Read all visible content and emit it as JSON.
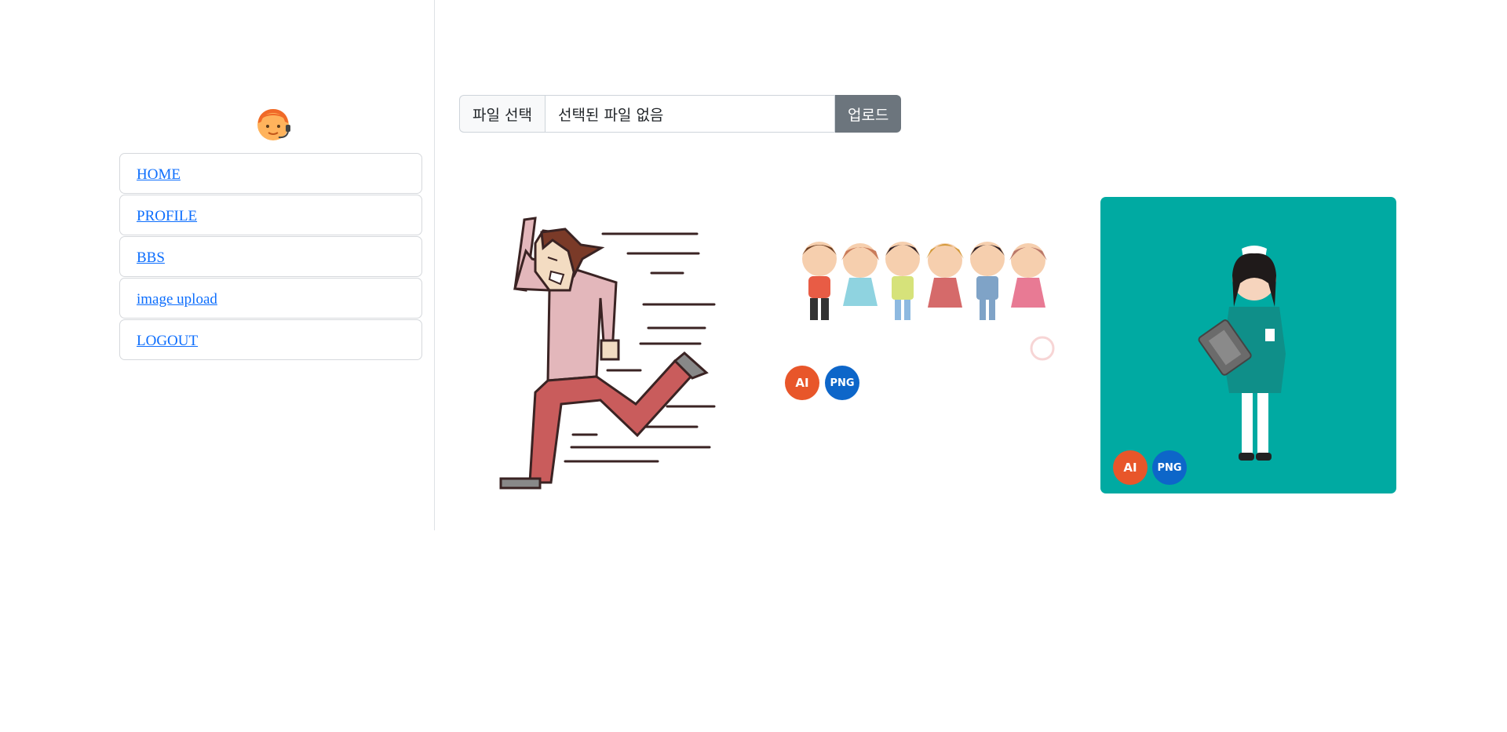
{
  "sidebar": {
    "avatar_icon": "support-agent-avatar-icon",
    "items": [
      {
        "label": "HOME"
      },
      {
        "label": "PROFILE"
      },
      {
        "label": "BBS"
      },
      {
        "label": "image upload"
      },
      {
        "label": "LOGOUT"
      }
    ]
  },
  "upload_form": {
    "choose_file_label": "파일 선택",
    "file_status": "선택된 파일 없음",
    "upload_button_label": "업로드",
    "upload_button_color": "#6c757d"
  },
  "gallery": {
    "images": [
      {
        "subject": "running-man-illustration",
        "badges": []
      },
      {
        "subject": "children-holding-hands-illustration",
        "badges": [
          "AI",
          "PNG"
        ]
      },
      {
        "subject": "nurse-illustration",
        "background": "#00aaa2",
        "badges": [
          "AI",
          "PNG"
        ]
      }
    ]
  },
  "colors": {
    "link": "#0d6efd",
    "badge_ai": "#e8562a",
    "badge_png": "#0d66c9"
  }
}
